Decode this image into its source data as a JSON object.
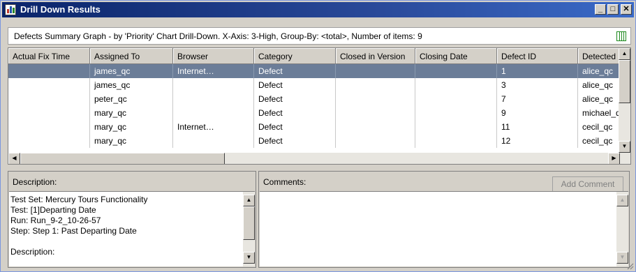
{
  "window": {
    "title": "Drill Down Results",
    "minimize": "_",
    "maximize": "□",
    "close": "✕"
  },
  "summary": {
    "text": "Defects Summary Graph - by 'Priority' Chart Drill-Down. X-Axis: 3-High, Group-By: <total>, Number of items: 9"
  },
  "grid": {
    "columns": [
      "Actual Fix Time",
      "Assigned To",
      "Browser",
      "Category",
      "Closed in Version",
      "Closing Date",
      "Defect ID",
      "Detected B"
    ],
    "rows": [
      [
        "",
        "james_qc",
        "Internet…",
        "Defect",
        "",
        "",
        "1",
        "alice_qc"
      ],
      [
        "",
        "james_qc",
        "",
        "Defect",
        "",
        "",
        "3",
        "alice_qc"
      ],
      [
        "",
        "peter_qc",
        "",
        "Defect",
        "",
        "",
        "7",
        "alice_qc"
      ],
      [
        "",
        "mary_qc",
        "",
        "Defect",
        "",
        "",
        "9",
        "michael_q"
      ],
      [
        "",
        "mary_qc",
        "Internet…",
        "Defect",
        "",
        "",
        "11",
        "cecil_qc"
      ],
      [
        "",
        "mary_qc",
        "",
        "Defect",
        "",
        "",
        "12",
        "cecil_qc"
      ]
    ],
    "selected_row": 0
  },
  "description": {
    "label": "Description:",
    "lines": [
      "Test Set: Mercury Tours Functionality",
      "Test: [1]Departing Date",
      "Run: Run_9-2_10-26-57",
      "Step: Step 1: Past Departing Date",
      "",
      "Description:"
    ]
  },
  "comments": {
    "label": "Comments:",
    "add_button": "Add Comment"
  }
}
